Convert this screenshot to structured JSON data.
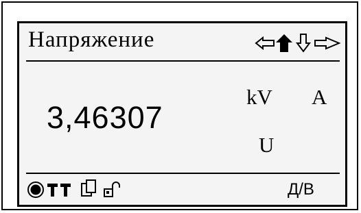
{
  "screen": {
    "title": "Напряжение",
    "value": "3,46307",
    "unit_primary": "kV",
    "unit_secondary": "A",
    "quantity_symbol": "U",
    "mode": "Д/В"
  },
  "icons": {
    "nav": [
      "arrow-left-outline-icon",
      "arrow-up-filled-icon",
      "arrow-down-outline-icon",
      "arrow-right-outline-icon"
    ],
    "status": [
      "record-dot-icon",
      "terminal-icon",
      "terminal-icon",
      "copy-pages-icon",
      "unlocked-padlock-icon"
    ]
  },
  "colors": {
    "display_background": "#f4f4f4",
    "ink": "#000000"
  }
}
